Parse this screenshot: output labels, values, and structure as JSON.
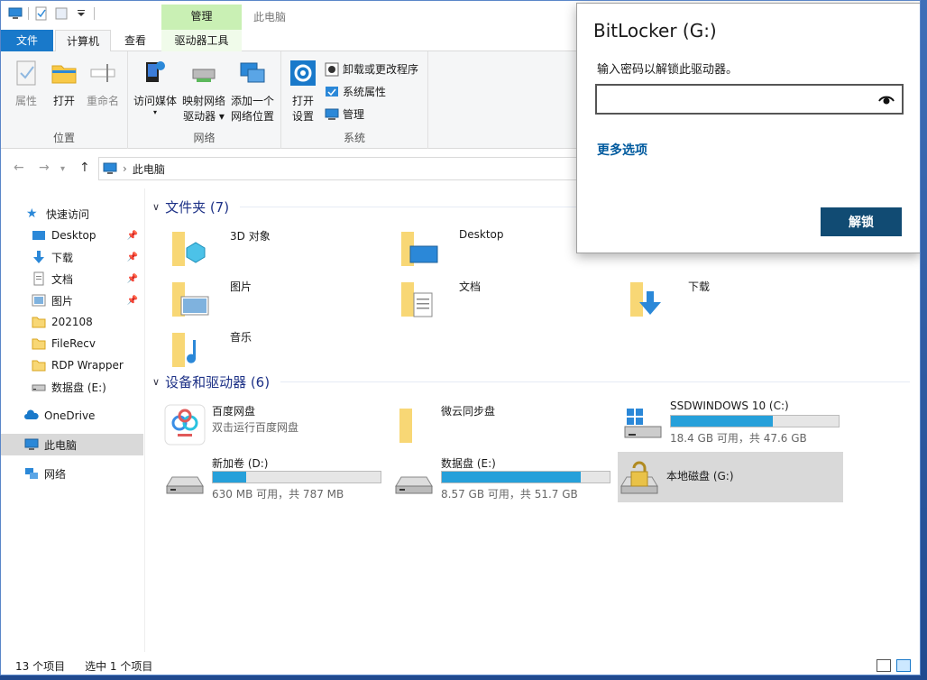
{
  "window": {
    "title": "此电脑",
    "manage_context": "管理"
  },
  "tabs": {
    "file": "文件",
    "computer": "计算机",
    "view": "查看",
    "drive_tools": "驱动器工具"
  },
  "ribbon": {
    "location": {
      "label": "位置",
      "properties": "属性",
      "open": "打开",
      "rename": "重命名"
    },
    "network": {
      "label": "网络",
      "access_media": "访问媒体",
      "map_drive_line1": "映射网络",
      "map_drive_line2": "驱动器",
      "add_location_line1": "添加一个",
      "add_location_line2": "网络位置"
    },
    "system": {
      "label": "系统",
      "open_settings_line1": "打开",
      "open_settings_line2": "设置",
      "uninstall": "卸载或更改程序",
      "system_props": "系统属性",
      "manage": "管理"
    }
  },
  "address": {
    "path": "此电脑"
  },
  "nav": {
    "quick_access": "快速访问",
    "items": [
      {
        "label": "Desktop",
        "pinned": true
      },
      {
        "label": "下载",
        "pinned": true
      },
      {
        "label": "文档",
        "pinned": true
      },
      {
        "label": "图片",
        "pinned": true
      },
      {
        "label": "202108",
        "pinned": false
      },
      {
        "label": "FileRecv",
        "pinned": false
      },
      {
        "label": "RDP Wrapper",
        "pinned": false
      },
      {
        "label": "数据盘 (E:)",
        "pinned": false
      }
    ],
    "onedrive": "OneDrive",
    "this_pc": "此电脑",
    "network": "网络"
  },
  "folders": {
    "header": "文件夹 (7)",
    "items": [
      "3D 对象",
      "Desktop",
      "图片",
      "文档",
      "下载",
      "音乐"
    ]
  },
  "devices": {
    "header": "设备和驱动器 (6)",
    "baidu": {
      "name": "百度网盘",
      "sub": "双击运行百度网盘"
    },
    "weiyun": {
      "name": "微云同步盘"
    },
    "c": {
      "name": "SSDWINDOWS 10 (C:)",
      "free": "18.4 GB 可用，共 47.6 GB",
      "used": 0.61
    },
    "d": {
      "name": "新加卷 (D:)",
      "free": "630 MB 可用，共 787 MB",
      "used": 0.2
    },
    "e": {
      "name": "数据盘 (E:)",
      "free": "8.57 GB 可用，共 51.7 GB",
      "used": 0.83
    },
    "g": {
      "name": "本地磁盘 (G:)"
    }
  },
  "status": {
    "count": "13 个项目",
    "selected": "选中 1 个项目"
  },
  "bitlocker": {
    "title": "BitLocker (G:)",
    "prompt": "输入密码以解锁此驱动器。",
    "password_value": "",
    "more_options": "更多选项",
    "unlock": "解锁"
  },
  "colors": {
    "accent": "#1979ca",
    "drive_bar": "#26a0da",
    "unlock_button": "#114b73",
    "link": "#005a9e"
  }
}
